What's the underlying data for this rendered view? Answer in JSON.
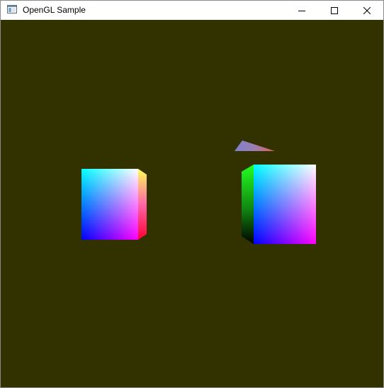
{
  "window": {
    "title": "OpenGL Sample",
    "icon": "app-window-icon",
    "controls": [
      {
        "name": "minimize",
        "icon": "minimize-icon"
      },
      {
        "name": "maximize",
        "icon": "maximize-icon"
      },
      {
        "name": "close",
        "icon": "close-icon"
      }
    ]
  },
  "scene": {
    "clear_color": "#323200",
    "objects": [
      "left-cube",
      "right-cube",
      "triangle"
    ]
  }
}
